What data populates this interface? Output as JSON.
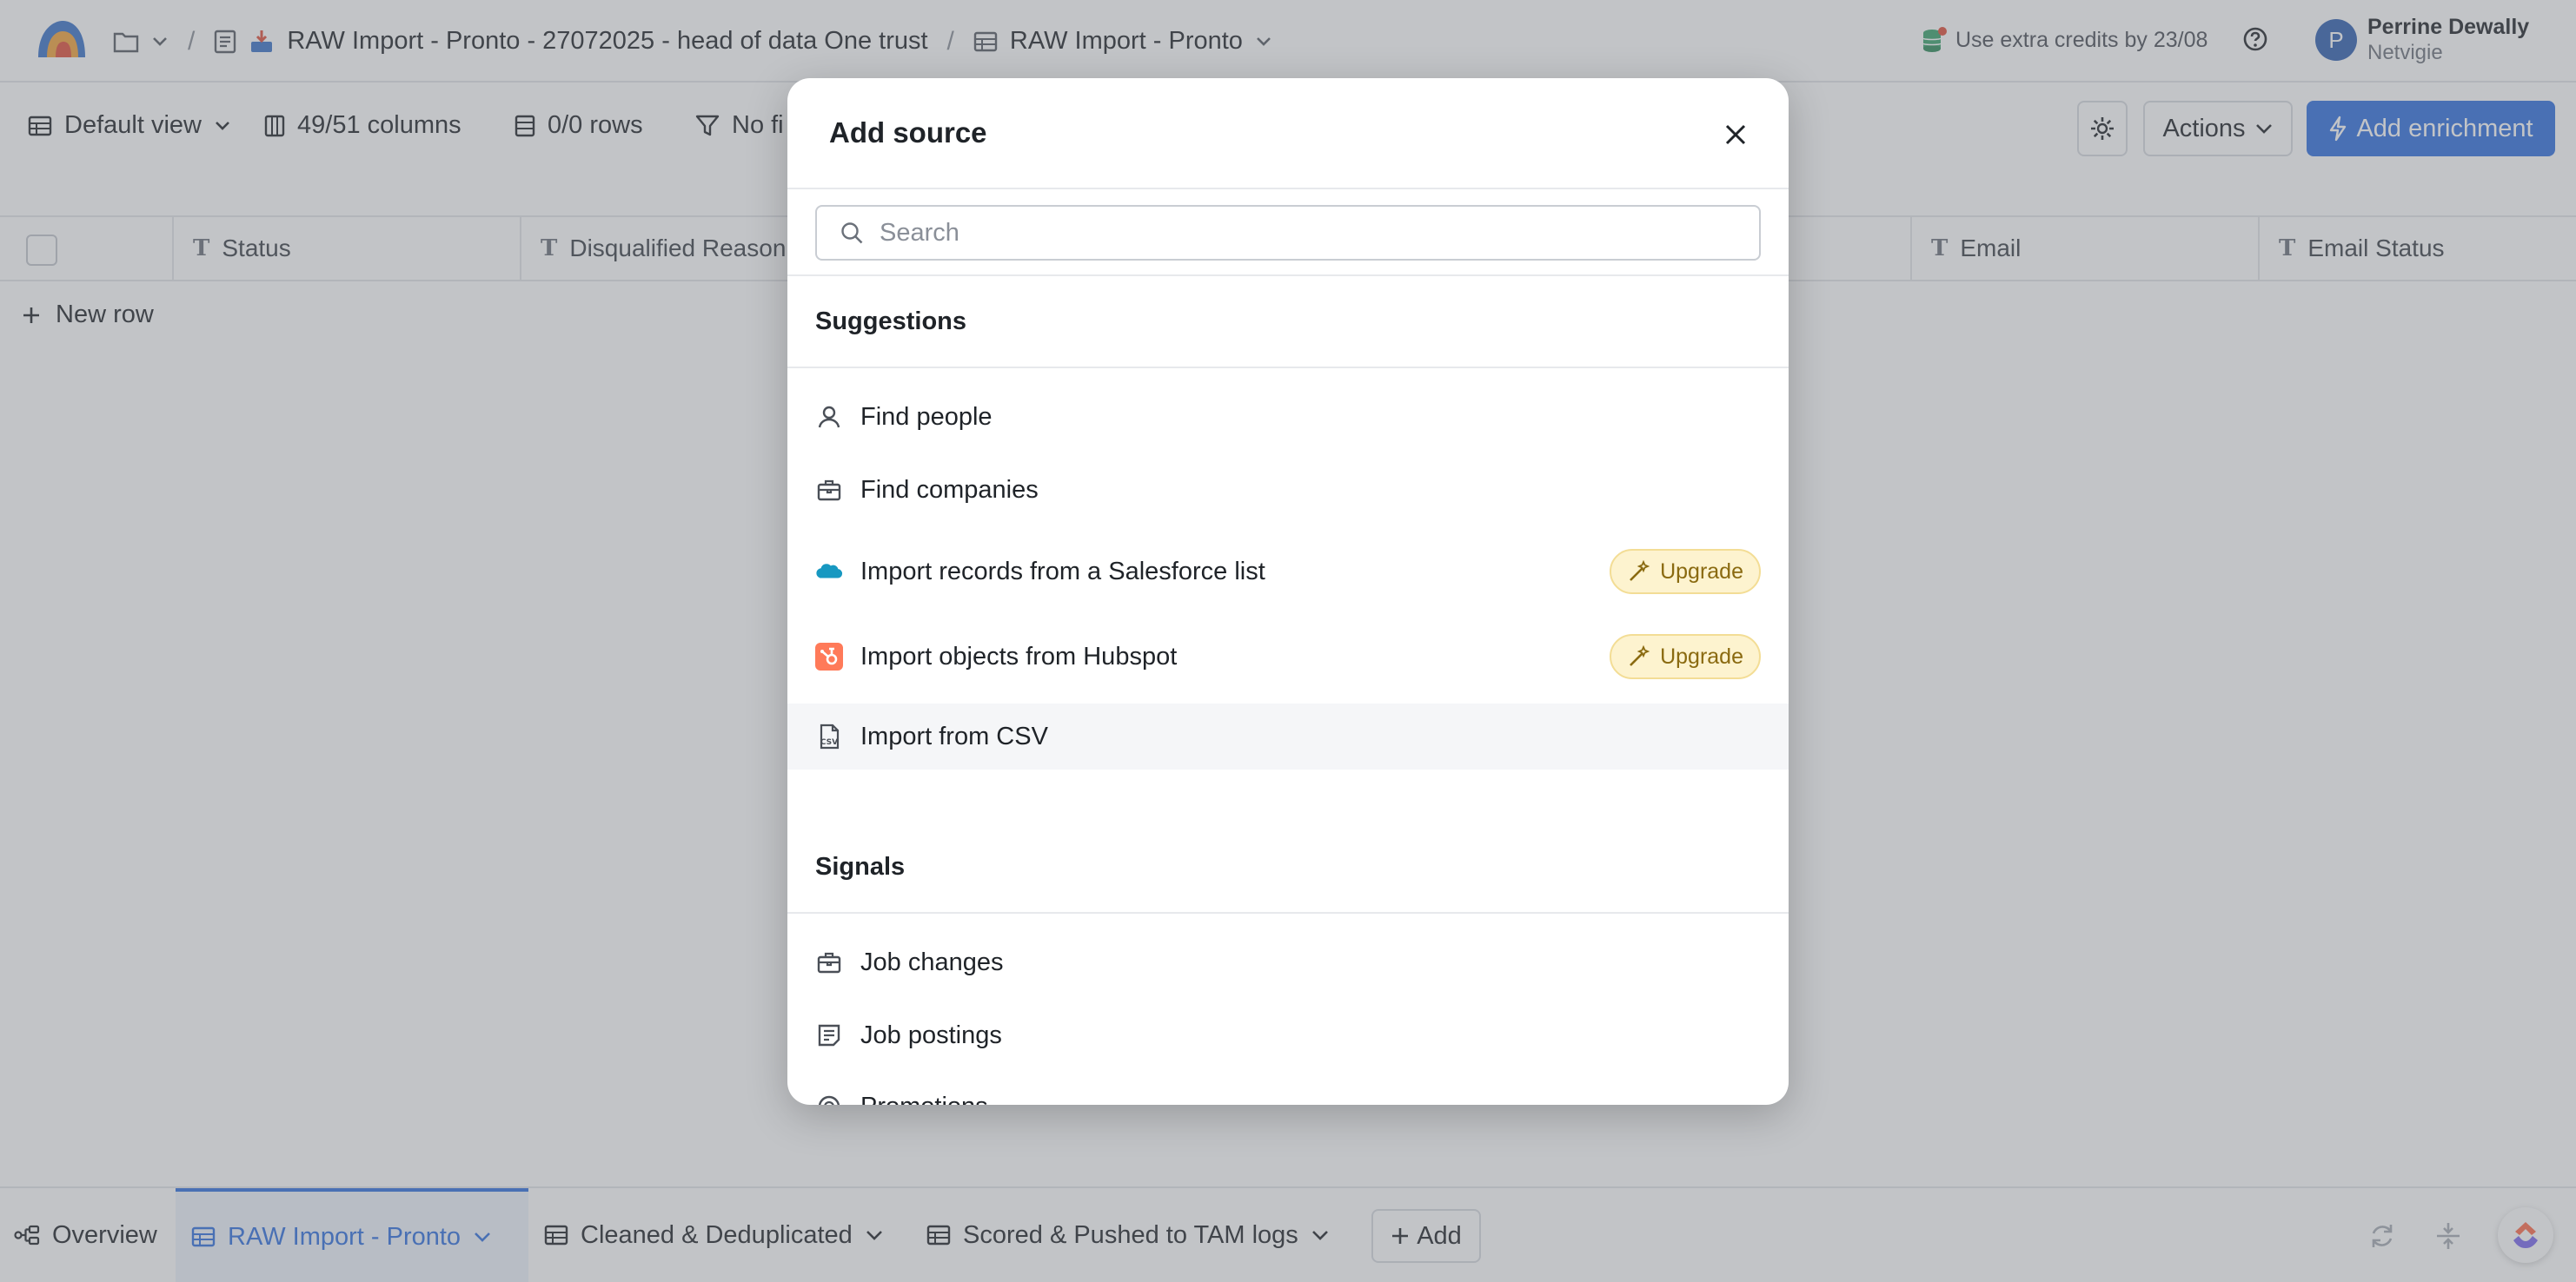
{
  "topbar": {
    "breadcrumb": {
      "workbook_title": "RAW Import - Pronto - 27072025 - head of data One trust",
      "sheet_title": "RAW Import - Pronto"
    },
    "credits_text": "Use extra credits by 23/08",
    "user": {
      "initial": "P",
      "name": "Perrine Dewally",
      "org": "Netvigie"
    }
  },
  "toolbar": {
    "view_label": "Default view",
    "columns_label": "49/51 columns",
    "rows_label": "0/0 rows",
    "filter_label": "No fi",
    "actions_label": "Actions",
    "add_enrichment_label": "Add enrichment"
  },
  "grid": {
    "columns": [
      "Status",
      "Disqualified Reason",
      "Email",
      "Email Status"
    ],
    "new_row_label": "New row"
  },
  "bottom_tabs": {
    "overview": "Overview",
    "raw_import": "RAW Import - Pronto",
    "cleaned": "Cleaned & Deduplicated",
    "scored": "Scored & Pushed to TAM logs",
    "add": "Add"
  },
  "modal": {
    "title": "Add source",
    "search_placeholder": "Search",
    "suggestions_title": "Suggestions",
    "suggestions": [
      {
        "label": "Find people",
        "icon": "person-icon"
      },
      {
        "label": "Find companies",
        "icon": "briefcase-icon"
      },
      {
        "label": "Import records from a Salesforce list",
        "icon": "salesforce-icon",
        "badge": "Upgrade"
      },
      {
        "label": "Import objects from Hubspot",
        "icon": "hubspot-icon",
        "badge": "Upgrade"
      },
      {
        "label": "Import from CSV",
        "icon": "csv-file-icon"
      }
    ],
    "signals_title": "Signals",
    "signals": [
      {
        "label": "Job changes",
        "icon": "briefcase-icon"
      },
      {
        "label": "Job postings",
        "icon": "job-posting-icon"
      },
      {
        "label": "Promotions",
        "icon": "promotion-icon"
      }
    ]
  },
  "colors": {
    "accent": "#2f6fde",
    "upgrade_badge_bg": "#fdf3cf",
    "upgrade_badge_text": "#8a6a10",
    "hubspot": "#ff7a59",
    "salesforce": "#1798c1"
  }
}
